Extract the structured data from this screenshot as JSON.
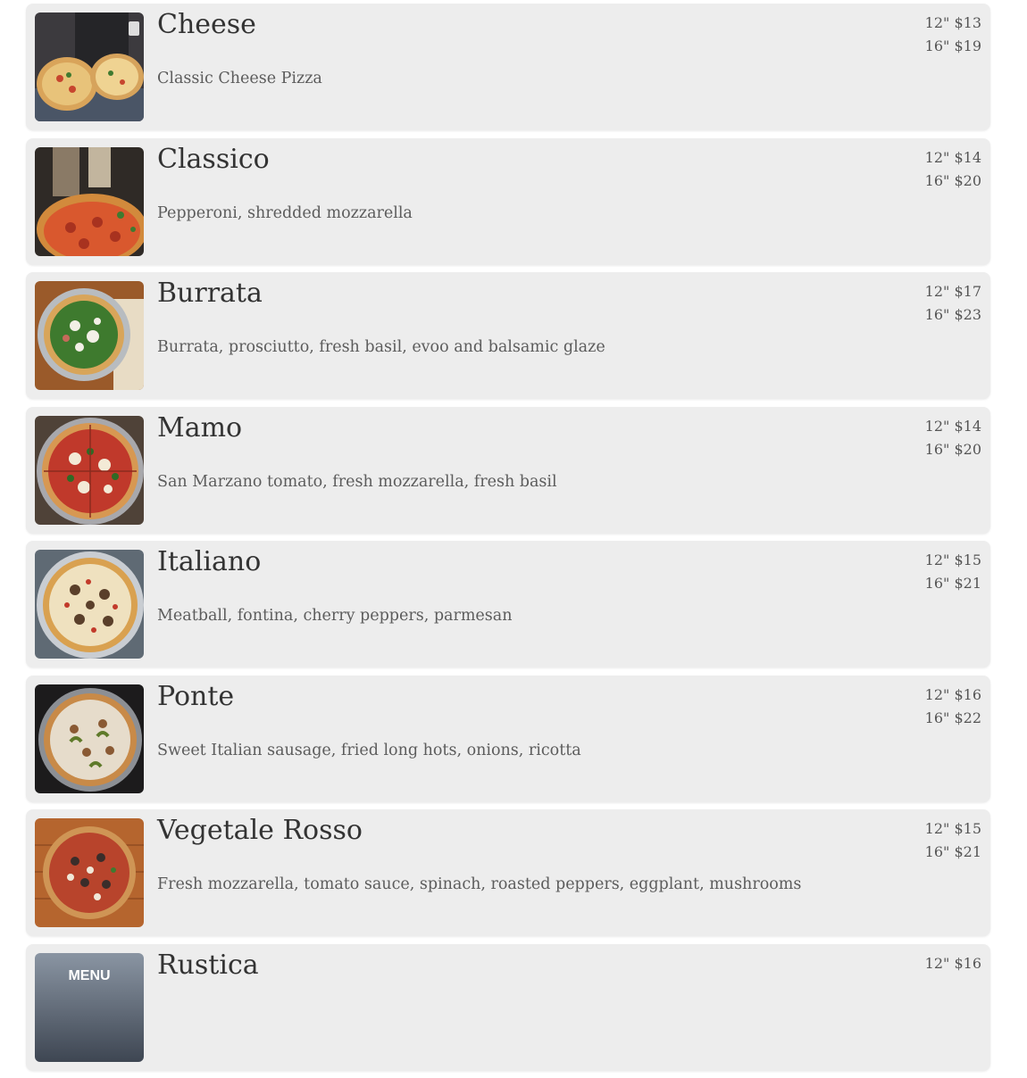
{
  "menu": {
    "items": [
      {
        "name": "Cheese",
        "description": "Classic Cheese Pizza",
        "prices": [
          "12\" $13",
          "16\" $19"
        ],
        "image": "cheese-pizza-photo"
      },
      {
        "name": "Classico",
        "description": "Pepperoni, shredded mozzarella",
        "prices": [
          "12\" $14",
          "16\" $20"
        ],
        "image": "classico-pizza-photo"
      },
      {
        "name": "Burrata",
        "description": "Burrata, prosciutto, fresh basil, evoo and balsamic glaze",
        "prices": [
          "12\" $17",
          "16\" $23"
        ],
        "image": "burrata-pizza-photo"
      },
      {
        "name": "Mamo",
        "description": "San Marzano tomato, fresh mozzarella, fresh basil",
        "prices": [
          "12\" $14",
          "16\" $20"
        ],
        "image": "mamo-pizza-photo"
      },
      {
        "name": "Italiano",
        "description": "Meatball, fontina, cherry peppers, parmesan",
        "prices": [
          "12\" $15",
          "16\" $21"
        ],
        "image": "italiano-pizza-photo"
      },
      {
        "name": "Ponte",
        "description": "Sweet Italian sausage, fried long hots, onions, ricotta",
        "prices": [
          "12\" $16",
          "16\" $22"
        ],
        "image": "ponte-pizza-photo"
      },
      {
        "name": "Vegetale Rosso",
        "description": "Fresh mozzarella, tomato sauce, spinach, roasted peppers, eggplant, mushrooms",
        "prices": [
          "12\" $15",
          "16\" $21"
        ],
        "image": "vegetale-rosso-pizza-photo"
      },
      {
        "name": "Rustica",
        "description": "",
        "prices": [
          "12\" $16",
          ""
        ],
        "image": "rustica-menu-photo",
        "image_text": "MENU"
      }
    ]
  }
}
